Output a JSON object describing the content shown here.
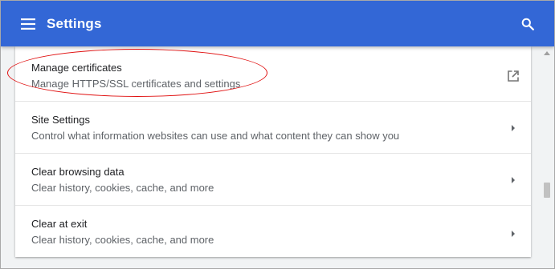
{
  "header": {
    "title": "Settings",
    "menu_icon": "hamburger-menu-icon",
    "search_icon": "search-icon",
    "color": "#3367d6"
  },
  "settings": {
    "items": [
      {
        "label": "Manage certificates",
        "description": "Manage HTTPS/SSL certificates and settings",
        "action_icon": "external-link-icon"
      },
      {
        "label": "Site Settings",
        "description": "Control what information websites can use and what content they can show you",
        "action_icon": "chevron-right-icon"
      },
      {
        "label": "Clear browsing data",
        "description": "Clear history, cookies, cache, and more",
        "action_icon": "chevron-right-icon"
      },
      {
        "label": "Clear at exit",
        "description": "Clear history, cookies, cache, and more",
        "action_icon": "chevron-right-icon"
      }
    ]
  },
  "annotation": {
    "highlight_color": "#e01010"
  }
}
